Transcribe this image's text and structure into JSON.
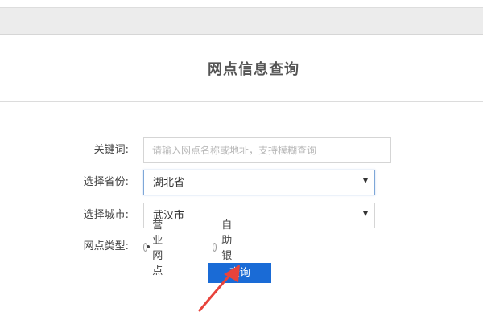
{
  "page": {
    "title": "网点信息查询"
  },
  "form": {
    "keyword": {
      "label": "关键词:",
      "value": "",
      "placeholder": "请输入网点名称或地址，支持模糊查询"
    },
    "province": {
      "label": "选择省份:",
      "selected": "湖北省"
    },
    "city": {
      "label": "选择城市:",
      "selected": "武汉市"
    },
    "outlet_type": {
      "label": "网点类型:",
      "options": [
        {
          "label": "营业网点",
          "checked": true
        },
        {
          "label": "自助银行",
          "checked": false
        }
      ]
    },
    "submit_label": "查询"
  },
  "colors": {
    "primary_button": "#1a6bd6",
    "annotation_arrow": "#e8433b"
  }
}
